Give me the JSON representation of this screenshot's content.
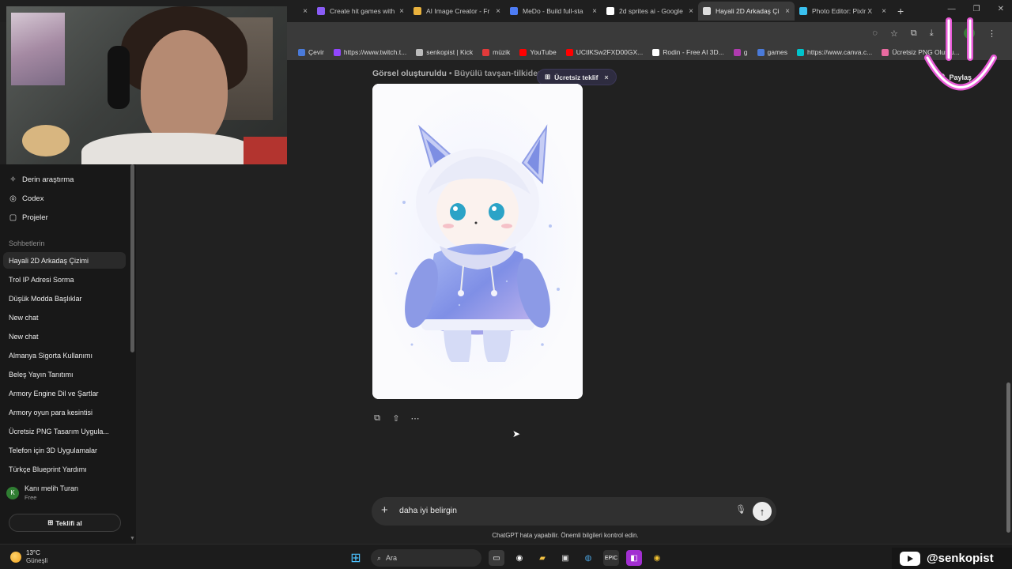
{
  "browser": {
    "tabs": [
      {
        "title": "Create hit games with",
        "favicon_color": "#8a5cf6"
      },
      {
        "title": "AI Image Creator - Fr",
        "favicon_color": "#e9b23d"
      },
      {
        "title": "MeDo - Build full-sta",
        "favicon_color": "#4d7cf5"
      },
      {
        "title": "2d sprites ai - Google",
        "favicon_color": "#ffffff"
      },
      {
        "title": "Hayali 2D Arkadaş Çi",
        "favicon_color": "#dddddd",
        "active": true
      },
      {
        "title": "Photo Editor: Pixlr X",
        "favicon_color": "#3ac1f0"
      }
    ],
    "new_tab": "+",
    "account_initial": "K",
    "bookmarks": [
      {
        "label": "Çevir",
        "color": "#4a7ad9"
      },
      {
        "label": "https://www.twitch.t...",
        "color": "#9146ff"
      },
      {
        "label": "senkopist | Kick",
        "color": "#bbbbbb"
      },
      {
        "label": "müzik",
        "color": "#e23a3a"
      },
      {
        "label": "YouTube",
        "color": "#ff0000"
      },
      {
        "label": "UCtlKSw2FXD00GX...",
        "color": "#ff0000"
      },
      {
        "label": "Rodin - Free AI 3D...",
        "color": "#ffffff"
      },
      {
        "label": "g",
        "color": "#b03bb0"
      },
      {
        "label": "games",
        "color": "#4a7ad9"
      },
      {
        "label": "https://www.canva.c...",
        "color": "#00c4cc"
      },
      {
        "label": "Ücretsiz PNG Oluştu...",
        "color": "#e86aa0"
      }
    ]
  },
  "sidebar": {
    "tools": [
      {
        "label": "Derin araştırma",
        "icon": "telescope-icon",
        "glyph": "✧"
      },
      {
        "label": "Codex",
        "icon": "codex-icon",
        "glyph": "◎"
      },
      {
        "label": "Projeler",
        "icon": "folder-icon",
        "glyph": "▢"
      }
    ],
    "section_title": "Sohbetlerin",
    "chats": [
      {
        "label": "Hayali 2D Arkadaş Çizimi",
        "active": true
      },
      {
        "label": "Trol IP Adresi Sorma"
      },
      {
        "label": "Düşük Modda Başlıklar"
      },
      {
        "label": "New chat"
      },
      {
        "label": "New chat"
      },
      {
        "label": "Almanya Sigorta Kullanımı"
      },
      {
        "label": "Beleş Yayın Tanıtımı"
      },
      {
        "label": "Armory Engine Dil ve Şartlar"
      },
      {
        "label": "Armory oyun para kesintisi"
      },
      {
        "label": "Ücretsiz PNG Tasarım Uygula..."
      },
      {
        "label": "Telefon için 3D Uygulamalar"
      },
      {
        "label": "Türkçe Blueprint Yardımı"
      }
    ],
    "user": {
      "initial": "K",
      "name": "Kanı melih Turan",
      "plan": "Free"
    },
    "offer_button": "Teklifi al"
  },
  "main": {
    "generation_title": "Görsel oluşturuldu",
    "generation_subtitle": " • Büyülü tavşan-tilkiden",
    "offer_pill": "Ücretsiz teklif",
    "share_label": "Paylaş",
    "composer_text": "daha iyi belirgin",
    "disclaimer": "ChatGPT hata yapabilir. Önemli bilgileri kontrol edin."
  },
  "taskbar": {
    "temperature": "13°C",
    "city": "Güneşli",
    "search_placeholder": "Ara"
  },
  "overlay": {
    "channel": "@senkopist"
  }
}
